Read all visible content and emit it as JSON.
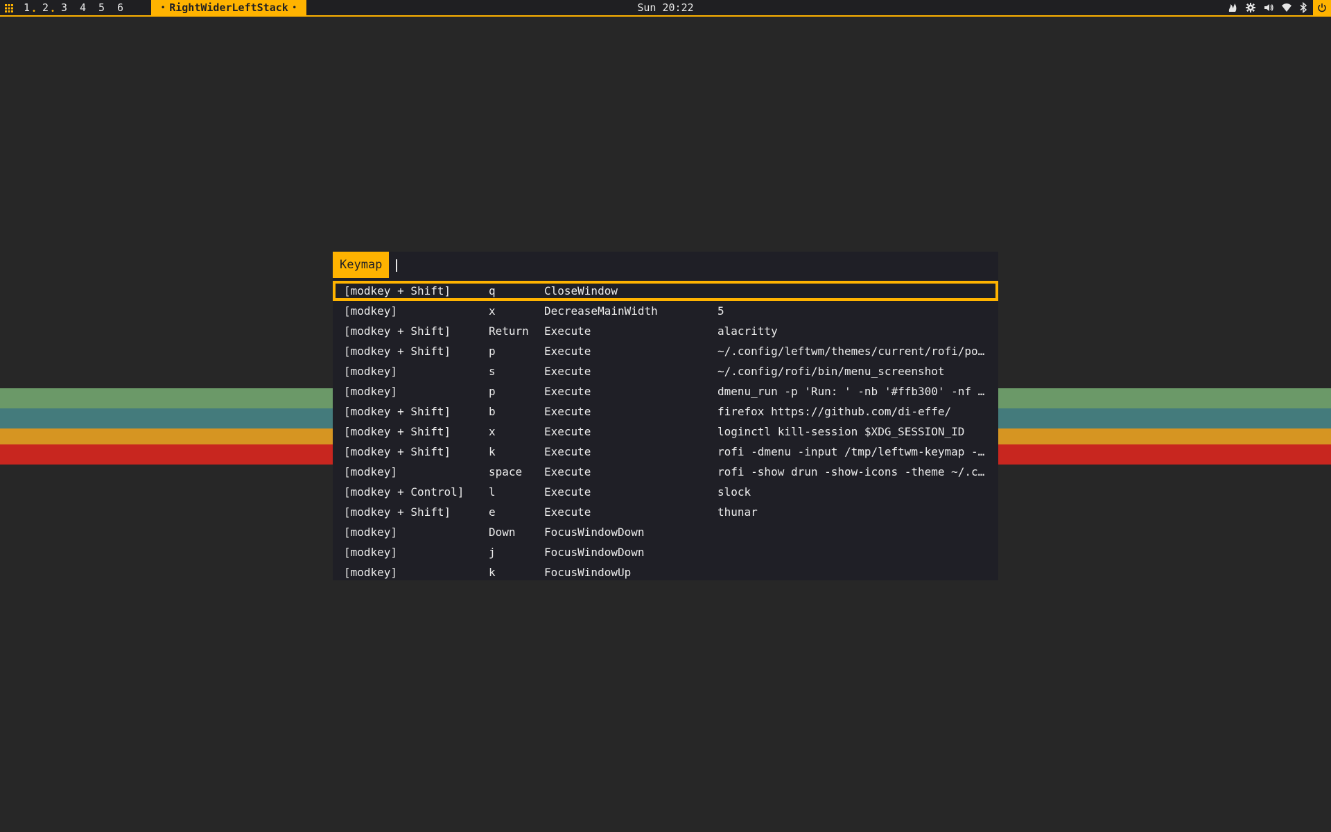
{
  "topbar": {
    "workspaces": [
      {
        "label": "1",
        "has_windows": true
      },
      {
        "label": "2",
        "has_windows": true
      },
      {
        "label": "3",
        "has_windows": false
      },
      {
        "label": "4",
        "has_windows": false
      },
      {
        "label": "5",
        "has_windows": false
      },
      {
        "label": "6",
        "has_windows": false
      }
    ],
    "layout_name": "RightWiderLeftStack",
    "clock": "Sun 20:22",
    "tray_icons": [
      "launcher-grid-icon",
      "flame-icon",
      "gear-icon",
      "volume-icon",
      "wifi-icon",
      "bluetooth-icon",
      "power-icon"
    ]
  },
  "colors": {
    "accent": "#ffb300",
    "background": "#272727",
    "panel": "#1f1f26",
    "stripe_green": "#6b9968",
    "stripe_teal": "#447b7c",
    "stripe_orange": "#d69522",
    "stripe_red": "#c8261f"
  },
  "rofi": {
    "prompt": "Keymap",
    "input_value": "",
    "selected_index": 0,
    "rows": [
      {
        "modifier": "[modkey + Shift]",
        "key": "q",
        "command": "CloseWindow",
        "argument": ""
      },
      {
        "modifier": "[modkey]",
        "key": "x",
        "command": "DecreaseMainWidth",
        "argument": "5"
      },
      {
        "modifier": "[modkey + Shift]",
        "key": "Return",
        "command": "Execute",
        "argument": "alacritty"
      },
      {
        "modifier": "[modkey + Shift]",
        "key": "p",
        "command": "Execute",
        "argument": "~/.config/leftwm/themes/current/rofi/po…"
      },
      {
        "modifier": "[modkey]",
        "key": "s",
        "command": "Execute",
        "argument": "~/.config/rofi/bin/menu_screenshot"
      },
      {
        "modifier": "[modkey]",
        "key": "p",
        "command": "Execute",
        "argument": "dmenu_run -p 'Run: ' -nb '#ffb300' -nf …"
      },
      {
        "modifier": "[modkey + Shift]",
        "key": "b",
        "command": "Execute",
        "argument": "firefox https://github.com/di-effe/"
      },
      {
        "modifier": "[modkey + Shift]",
        "key": "x",
        "command": "Execute",
        "argument": "loginctl kill-session $XDG_SESSION_ID"
      },
      {
        "modifier": "[modkey + Shift]",
        "key": "k",
        "command": "Execute",
        "argument": "rofi -dmenu -input /tmp/leftwm-keymap -…"
      },
      {
        "modifier": "[modkey]",
        "key": "space",
        "command": "Execute",
        "argument": "rofi -show drun -show-icons -theme ~/.c…"
      },
      {
        "modifier": "[modkey + Control]",
        "key": "l",
        "command": "Execute",
        "argument": "slock"
      },
      {
        "modifier": "[modkey + Shift]",
        "key": "e",
        "command": "Execute",
        "argument": "thunar"
      },
      {
        "modifier": "[modkey]",
        "key": "Down",
        "command": "FocusWindowDown",
        "argument": ""
      },
      {
        "modifier": "[modkey]",
        "key": "j",
        "command": "FocusWindowDown",
        "argument": ""
      },
      {
        "modifier": "[modkey]",
        "key": "k",
        "command": "FocusWindowUp",
        "argument": ""
      }
    ]
  }
}
